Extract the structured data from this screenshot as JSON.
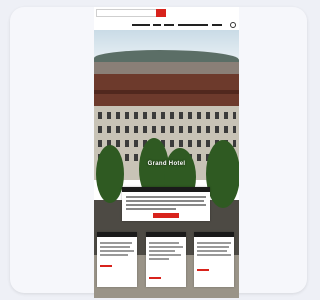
{
  "page": {
    "hero_title": "Grand Hotel",
    "nav_items": [
      "",
      "",
      "",
      "",
      ""
    ],
    "cookie_banner": {
      "button_label": ""
    },
    "info_cards": [
      {
        "title": ""
      },
      {
        "title": ""
      },
      {
        "title": ""
      }
    ]
  },
  "colors": {
    "accent": "#d8231c",
    "dark": "#1a1a1a"
  }
}
